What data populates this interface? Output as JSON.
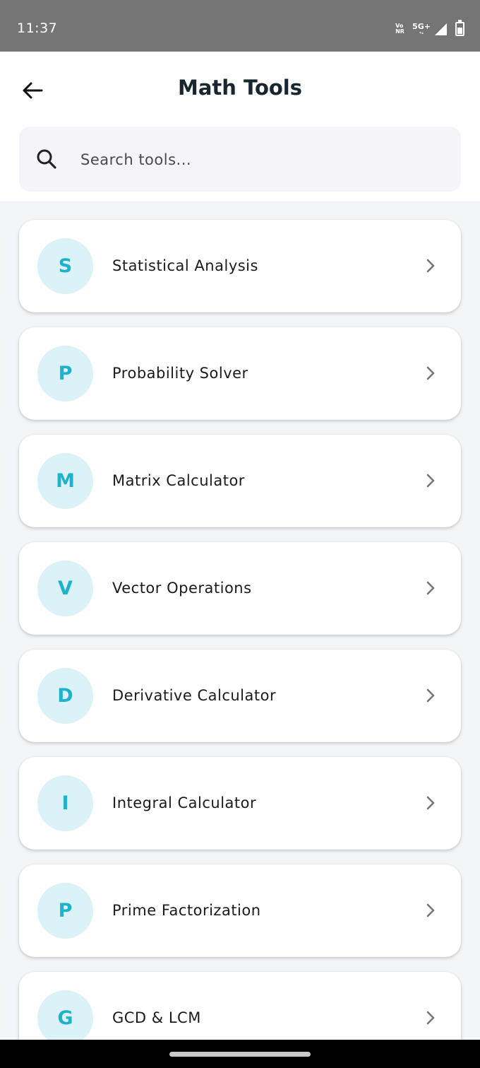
{
  "status_bar": {
    "time": "11:37",
    "volte_top": "Vo",
    "volte_bottom": "NR",
    "network": "5G+"
  },
  "header": {
    "title": "Math Tools"
  },
  "search": {
    "placeholder": "Search tools..."
  },
  "tools": [
    {
      "letter": "S",
      "label": "Statistical Analysis"
    },
    {
      "letter": "P",
      "label": "Probability Solver"
    },
    {
      "letter": "M",
      "label": "Matrix Calculator"
    },
    {
      "letter": "V",
      "label": "Vector Operations"
    },
    {
      "letter": "D",
      "label": "Derivative Calculator"
    },
    {
      "letter": "I",
      "label": "Integral Calculator"
    },
    {
      "letter": "P",
      "label": "Prime Factorization"
    },
    {
      "letter": "G",
      "label": "GCD & LCM"
    }
  ],
  "colors": {
    "accent": "#1fb2cd",
    "avatar_bg": "#dbf3f8",
    "title": "#17262f",
    "background": "#f4f5f9"
  },
  "icons": {
    "back": "arrow-left-icon",
    "search": "search-icon",
    "row": "chevron-right-icon"
  }
}
